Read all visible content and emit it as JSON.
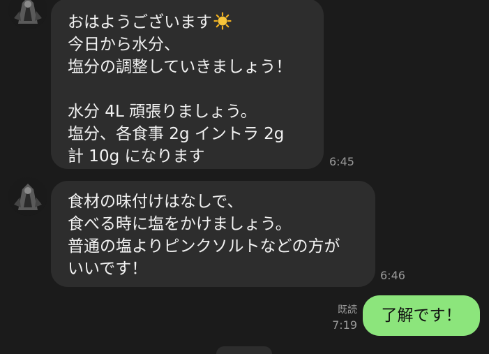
{
  "conversation": {
    "messages": [
      {
        "sender": "other",
        "lines": [
          "おはようございます",
          "今日から水分、",
          "塩分の調整していきましょう！",
          "",
          "水分 4L 頑張りましょう。",
          "塩分、各食事 2g イントラ 2g",
          "計 10g になります"
        ],
        "time": "6:45"
      },
      {
        "sender": "other",
        "lines": [
          "食材の味付けはなしで、",
          "食べる時に塩をかけましょう。",
          "普通の塩よりピンクソルトなどの方が",
          "いいです！"
        ],
        "time": "6:46"
      },
      {
        "sender": "me",
        "text": "了解です！",
        "read_label": "既読",
        "time": "7:19"
      }
    ]
  },
  "colors": {
    "background": "#1b1b1b",
    "incoming_bubble": "#2d2d2d",
    "outgoing_bubble": "#8ce57c",
    "timestamp": "#9a9a9a"
  },
  "icons": {
    "emoji": "sun-emoji-icon",
    "avatar": "contact-avatar"
  }
}
